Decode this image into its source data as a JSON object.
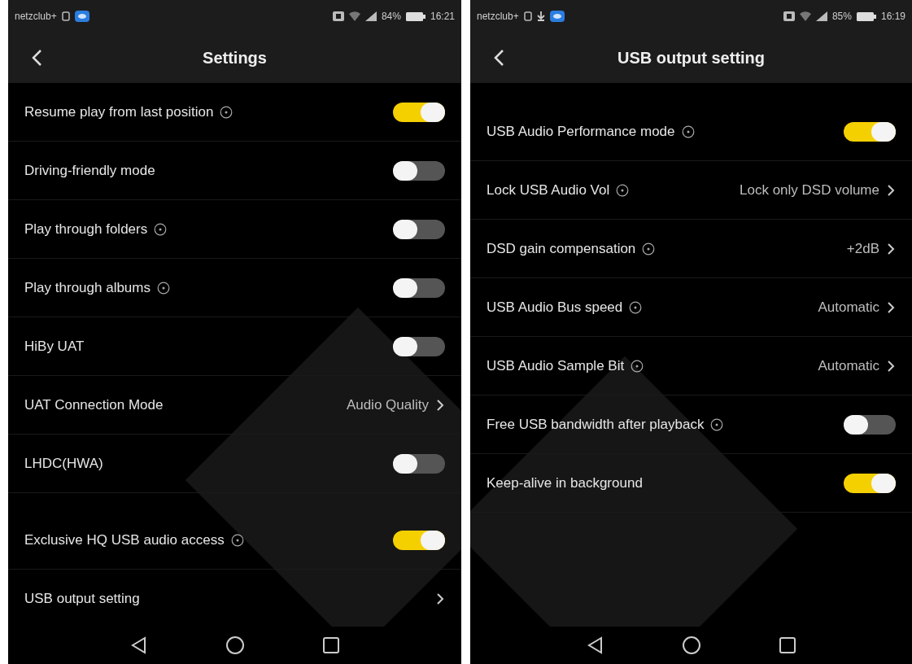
{
  "phones": [
    {
      "status_bar": {
        "carrier": "netzclub+",
        "download": false,
        "battery": "84%",
        "time": "16:21"
      },
      "header": {
        "title": "Settings"
      },
      "sections": [
        {
          "rows": [
            {
              "kind": "toggle",
              "label": "Resume play from last position",
              "info": true,
              "on": true
            },
            {
              "kind": "toggle",
              "label": "Driving-friendly mode",
              "info": false,
              "on": false
            },
            {
              "kind": "toggle",
              "label": "Play through folders",
              "info": true,
              "on": false
            },
            {
              "kind": "toggle",
              "label": "Play through albums",
              "info": true,
              "on": false
            },
            {
              "kind": "toggle",
              "label": "HiBy UAT",
              "info": false,
              "on": false
            },
            {
              "kind": "value",
              "label": "UAT Connection Mode",
              "info": false,
              "value": "Audio Quality"
            },
            {
              "kind": "toggle",
              "label": "LHDC(HWA)",
              "info": false,
              "on": false
            }
          ]
        },
        {
          "rows": [
            {
              "kind": "toggle",
              "label": "Exclusive HQ USB audio access",
              "info": true,
              "on": true
            },
            {
              "kind": "link",
              "label": "USB output setting",
              "info": false
            }
          ]
        }
      ]
    },
    {
      "status_bar": {
        "carrier": "netzclub+",
        "download": true,
        "battery": "85%",
        "time": "16:19"
      },
      "header": {
        "title": "USB output setting"
      },
      "sections": [
        {
          "rows": [
            {
              "kind": "toggle",
              "label": "USB Audio Performance mode",
              "info": true,
              "on": true
            },
            {
              "kind": "value",
              "label": "Lock USB Audio Vol",
              "info": true,
              "value": "Lock only DSD volume"
            },
            {
              "kind": "value",
              "label": "DSD gain compensation",
              "info": true,
              "value": "+2dB"
            },
            {
              "kind": "value",
              "label": "USB Audio Bus speed",
              "info": true,
              "value": "Automatic"
            },
            {
              "kind": "value",
              "label": "USB Audio Sample Bit",
              "info": true,
              "value": "Automatic"
            },
            {
              "kind": "toggle",
              "label": "Free USB bandwidth after playback",
              "info": true,
              "on": false
            },
            {
              "kind": "toggle",
              "label": "Keep-alive in background",
              "info": false,
              "on": true
            }
          ]
        }
      ]
    }
  ]
}
